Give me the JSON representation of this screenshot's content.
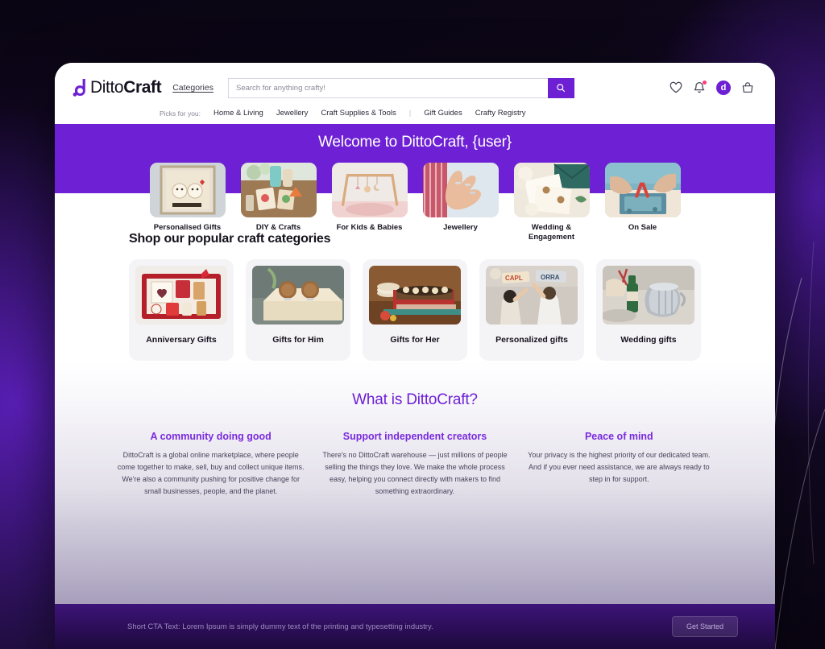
{
  "brand": {
    "name_light": "Ditto",
    "name_bold": "Craft",
    "mark_letter": "d",
    "accent": "#6d20d4"
  },
  "header": {
    "categories_label": "Categories",
    "search": {
      "placeholder": "Search for anything crafty!",
      "value": "",
      "button_icon": "search-icon"
    },
    "icons": [
      {
        "name": "heart-icon",
        "label": "Favourites"
      },
      {
        "name": "bell-icon",
        "label": "Notifications",
        "has_dot": true
      },
      {
        "name": "avatar",
        "label": "d"
      },
      {
        "name": "bag-icon",
        "label": "Cart"
      }
    ],
    "nav_lead": "Picks for you:",
    "nav_items": [
      "Home & Living",
      "Jewellery",
      "Craft Supplies & Tools",
      "|",
      "Gift Guides",
      "Crafty Registry"
    ]
  },
  "hero": {
    "title": "Welcome to DittoCraft, {user}",
    "bg": "#6d20d4",
    "categories": [
      {
        "label": "Personalised Gifts",
        "thumb": "framed-couple-art"
      },
      {
        "label": "DIY & Crafts",
        "thumb": "craft-supplies-table"
      },
      {
        "label": "For Kids & Babies",
        "thumb": "baby-play-gym"
      },
      {
        "label": "Jewellery",
        "thumb": "hand-with-rings"
      },
      {
        "label": "Wedding & Engagement",
        "thumb": "wedding-stationery"
      },
      {
        "label": "On Sale",
        "thumb": "crafting-hands-tools"
      }
    ]
  },
  "popular": {
    "title": "Shop our popular craft categories",
    "cards": [
      {
        "label": "Anniversary Gifts",
        "thumb": "red-gift-box"
      },
      {
        "label": "Gifts for Him",
        "thumb": "wooden-cufflinks-box"
      },
      {
        "label": "Gifts for Her",
        "thumb": "personalised-casserole-dish"
      },
      {
        "label": "Personalized gifts",
        "thumb": "kids-name-banner"
      },
      {
        "label": "Wedding gifts",
        "thumb": "silver-pitcher-champagne"
      }
    ]
  },
  "about": {
    "title": "What is DittoCraft?",
    "columns": [
      {
        "heading": "A community doing good",
        "body": "DittoCraft is a global online marketplace, where people come together to make, sell, buy and collect unique items. We're also a community pushing for positive change for small businesses, people, and the planet."
      },
      {
        "heading": "Support independent creators",
        "body": "There's no DittoCraft warehouse — just millions of people selling the things they love. We make the whole process easy, helping you connect directly with makers to find something extraordinary."
      },
      {
        "heading": "Peace of mind",
        "body": "Your privacy is the highest priority of our dedicated team. And if you ever need assistance, we are always ready to step in for support."
      }
    ]
  },
  "footer": {
    "cta_text": "Short CTA Text: Lorem Ipsum is simply dummy text of the printing and typesetting industry.",
    "cta_button": "Get Started"
  }
}
